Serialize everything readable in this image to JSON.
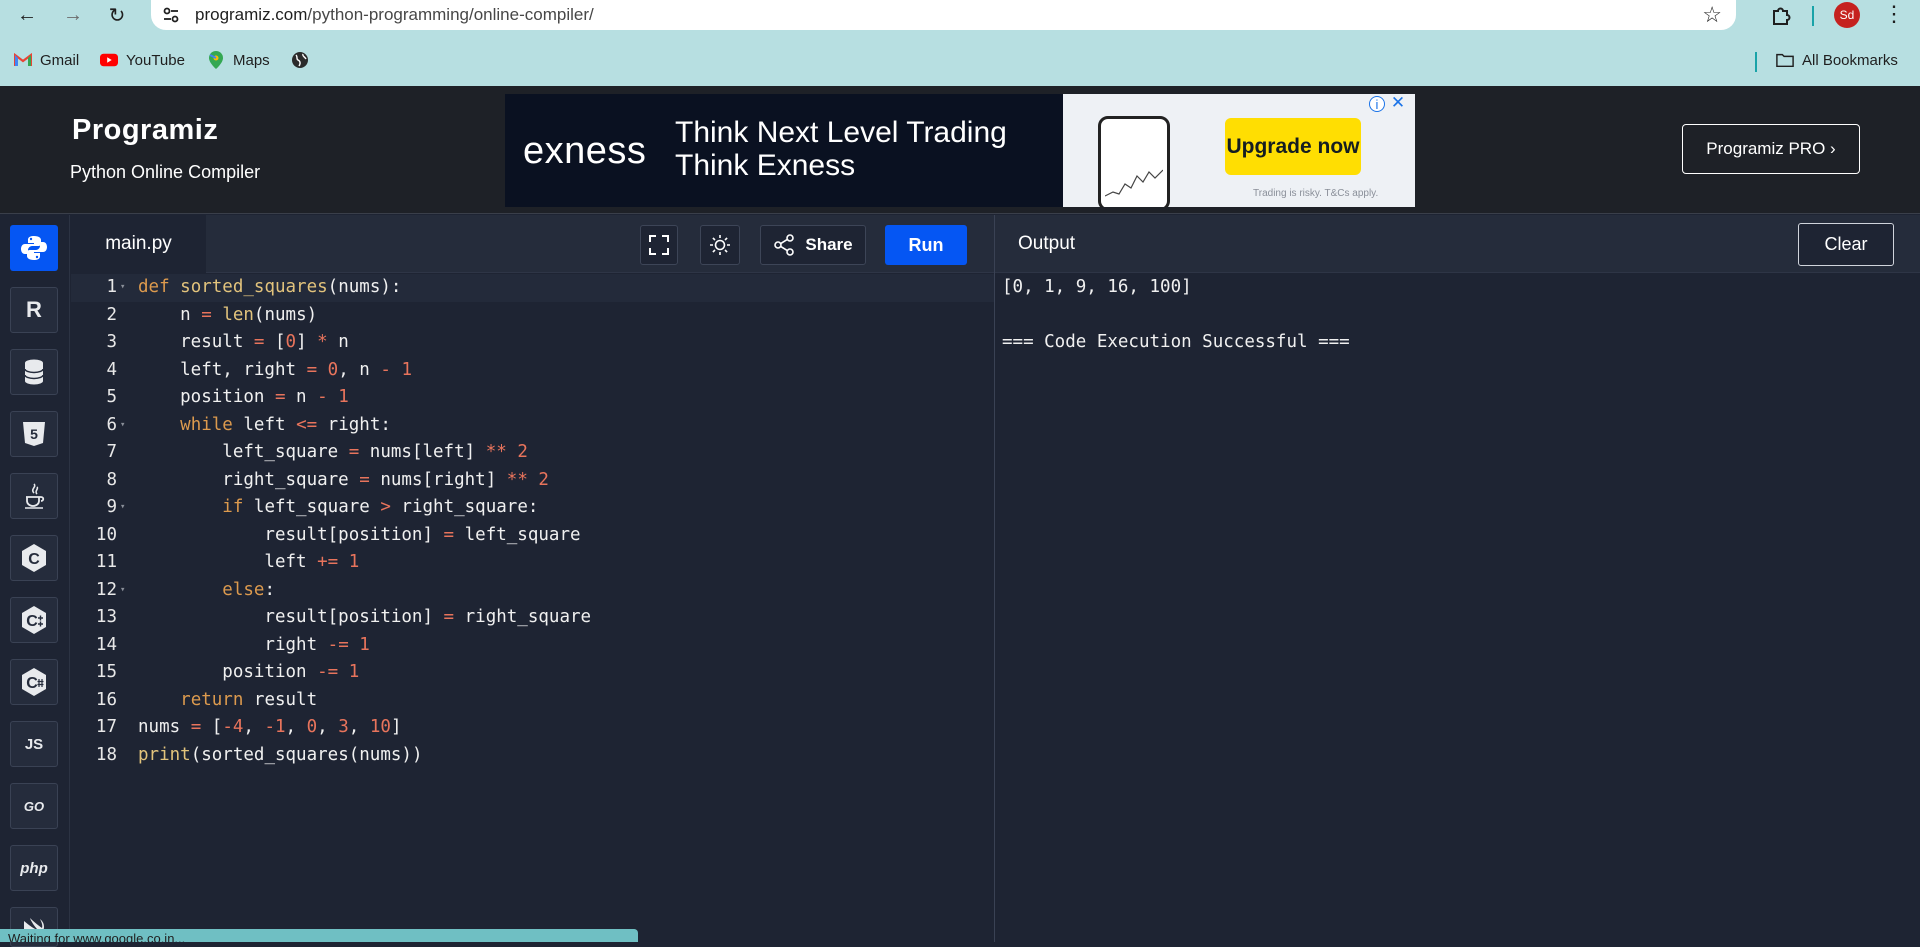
{
  "browser": {
    "url_host": "programiz.com",
    "url_path": "/python-programming/online-compiler/",
    "profile_initials": "Sd",
    "bookmarks": [
      {
        "label": "Gmail",
        "icon": "gmail-icon"
      },
      {
        "label": "YouTube",
        "icon": "youtube-icon"
      },
      {
        "label": "Maps",
        "icon": "maps-icon"
      },
      {
        "label": "",
        "icon": "globe-icon"
      }
    ],
    "all_bookmarks_label": "All Bookmarks"
  },
  "header": {
    "logo_text": "Programiz",
    "subtitle": "Python Online Compiler",
    "pro_button_label": "Programiz PRO ›"
  },
  "ad": {
    "brand": "exness",
    "headline_line1": "Think Next Level Trading",
    "headline_line2": "Think Exness",
    "cta_label": "Upgrade now",
    "disclaimer": "Trading is risky. T&Cs apply.",
    "brand_color": "#ffde02"
  },
  "sidebar": {
    "languages": [
      {
        "name": "python",
        "icon": "python-icon",
        "glyph": "",
        "active": true
      },
      {
        "name": "r",
        "icon": "r-icon",
        "glyph": "R",
        "active": false
      },
      {
        "name": "sql",
        "icon": "database-icon",
        "glyph": "",
        "active": false
      },
      {
        "name": "html",
        "icon": "html5-icon",
        "glyph": "5",
        "active": false
      },
      {
        "name": "java",
        "icon": "java-icon",
        "glyph": "",
        "active": false
      },
      {
        "name": "c",
        "icon": "c-icon",
        "glyph": "C",
        "active": false
      },
      {
        "name": "cpp",
        "icon": "cpp-icon",
        "glyph": "C",
        "active": false
      },
      {
        "name": "csharp",
        "icon": "csharp-icon",
        "glyph": "C",
        "active": false
      },
      {
        "name": "javascript",
        "icon": "js-icon",
        "glyph": "JS",
        "active": false
      },
      {
        "name": "go",
        "icon": "go-icon",
        "glyph": "GO",
        "active": false
      },
      {
        "name": "php",
        "icon": "php-icon",
        "glyph": "php",
        "active": false
      },
      {
        "name": "swift",
        "icon": "swift-icon",
        "glyph": "",
        "active": false
      }
    ]
  },
  "editor": {
    "file_tab": "main.py",
    "share_label": "Share",
    "run_label": "Run",
    "lines": [
      [
        {
          "t": "def",
          "c": "kw"
        },
        {
          "t": " "
        },
        {
          "t": "sorted_squares",
          "c": "fn"
        },
        {
          "t": "(nums):"
        }
      ],
      [
        {
          "t": "    n "
        },
        {
          "t": "=",
          "c": "op"
        },
        {
          "t": " "
        },
        {
          "t": "len",
          "c": "bi"
        },
        {
          "t": "(nums)"
        }
      ],
      [
        {
          "t": "    result "
        },
        {
          "t": "=",
          "c": "op"
        },
        {
          "t": " ["
        },
        {
          "t": "0",
          "c": "num"
        },
        {
          "t": "] "
        },
        {
          "t": "*",
          "c": "op"
        },
        {
          "t": " n"
        }
      ],
      [
        {
          "t": "    left, right "
        },
        {
          "t": "=",
          "c": "op"
        },
        {
          "t": " "
        },
        {
          "t": "0",
          "c": "num"
        },
        {
          "t": ", n "
        },
        {
          "t": "-",
          "c": "op"
        },
        {
          "t": " "
        },
        {
          "t": "1",
          "c": "num"
        }
      ],
      [
        {
          "t": "    position "
        },
        {
          "t": "=",
          "c": "op"
        },
        {
          "t": " n "
        },
        {
          "t": "-",
          "c": "op"
        },
        {
          "t": " "
        },
        {
          "t": "1",
          "c": "num"
        }
      ],
      [
        {
          "t": "    "
        },
        {
          "t": "while",
          "c": "kw"
        },
        {
          "t": " left "
        },
        {
          "t": "<=",
          "c": "op"
        },
        {
          "t": " right:"
        }
      ],
      [
        {
          "t": "        left_square "
        },
        {
          "t": "=",
          "c": "op"
        },
        {
          "t": " nums[left] "
        },
        {
          "t": "**",
          "c": "op"
        },
        {
          "t": " "
        },
        {
          "t": "2",
          "c": "num"
        }
      ],
      [
        {
          "t": "        right_square "
        },
        {
          "t": "=",
          "c": "op"
        },
        {
          "t": " nums[right] "
        },
        {
          "t": "**",
          "c": "op"
        },
        {
          "t": " "
        },
        {
          "t": "2",
          "c": "num"
        }
      ],
      [
        {
          "t": "        "
        },
        {
          "t": "if",
          "c": "kw"
        },
        {
          "t": " left_square "
        },
        {
          "t": ">",
          "c": "op"
        },
        {
          "t": " right_square:"
        }
      ],
      [
        {
          "t": "            result[position] "
        },
        {
          "t": "=",
          "c": "op"
        },
        {
          "t": " left_square"
        }
      ],
      [
        {
          "t": "            left "
        },
        {
          "t": "+=",
          "c": "op"
        },
        {
          "t": " "
        },
        {
          "t": "1",
          "c": "num"
        }
      ],
      [
        {
          "t": "        "
        },
        {
          "t": "else",
          "c": "kw"
        },
        {
          "t": ":"
        }
      ],
      [
        {
          "t": "            result[position] "
        },
        {
          "t": "=",
          "c": "op"
        },
        {
          "t": " right_square"
        }
      ],
      [
        {
          "t": "            right "
        },
        {
          "t": "-=",
          "c": "op"
        },
        {
          "t": " "
        },
        {
          "t": "1",
          "c": "num"
        }
      ],
      [
        {
          "t": "        position "
        },
        {
          "t": "-=",
          "c": "op"
        },
        {
          "t": " "
        },
        {
          "t": "1",
          "c": "num"
        }
      ],
      [
        {
          "t": "    "
        },
        {
          "t": "return",
          "c": "kw"
        },
        {
          "t": " result"
        }
      ],
      [
        {
          "t": "nums "
        },
        {
          "t": "=",
          "c": "op"
        },
        {
          "t": " ["
        },
        {
          "t": "-4",
          "c": "num"
        },
        {
          "t": ", "
        },
        {
          "t": "-1",
          "c": "num"
        },
        {
          "t": ", "
        },
        {
          "t": "0",
          "c": "num"
        },
        {
          "t": ", "
        },
        {
          "t": "3",
          "c": "num"
        },
        {
          "t": ", "
        },
        {
          "t": "10",
          "c": "num"
        },
        {
          "t": "]"
        }
      ],
      [
        {
          "t": "print",
          "c": "bi"
        },
        {
          "t": "(sorted_squares(nums))"
        }
      ]
    ],
    "fold_lines": [
      1,
      6,
      9,
      12
    ],
    "current_line": 1
  },
  "output": {
    "title": "Output",
    "clear_label": "Clear",
    "text": "[0, 1, 9, 16, 100]\n\n=== Code Execution Successful ==="
  },
  "status": {
    "text": "Waiting for www.google.co.in..."
  }
}
